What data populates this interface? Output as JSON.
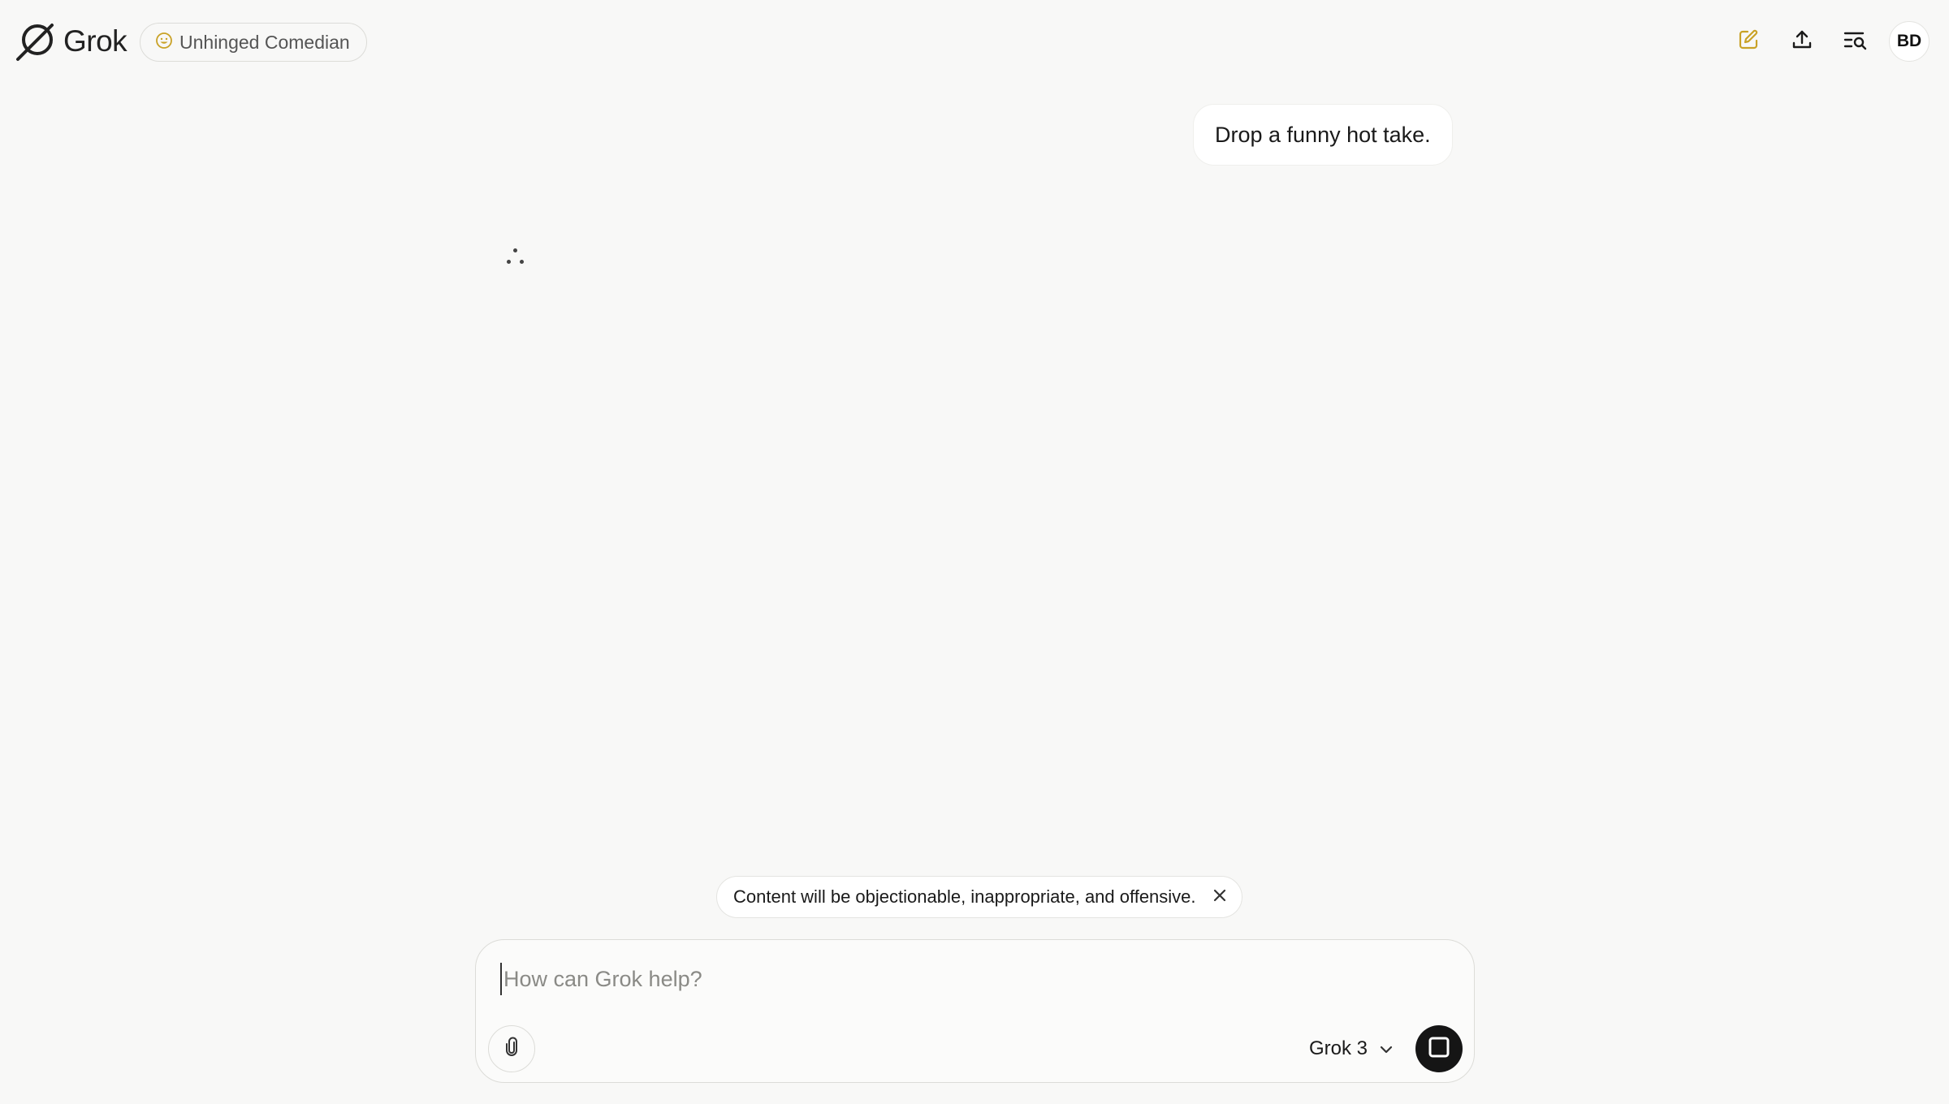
{
  "header": {
    "logo_text": "Grok",
    "persona_label": "Unhinged Comedian",
    "persona_icon": "smiley-icon",
    "accent_color": "#c9a227",
    "avatar_initials": "BD",
    "actions": [
      "new-chat-icon",
      "share-icon",
      "history-search-icon"
    ]
  },
  "conversation": {
    "user_message": "Drop a funny hot take.",
    "assistant_status": "loading"
  },
  "warning": {
    "text": "Content will be objectionable, inappropriate, and offensive."
  },
  "composer": {
    "placeholder": "How can Grok help?",
    "value": "",
    "model_label": "Grok 3"
  }
}
